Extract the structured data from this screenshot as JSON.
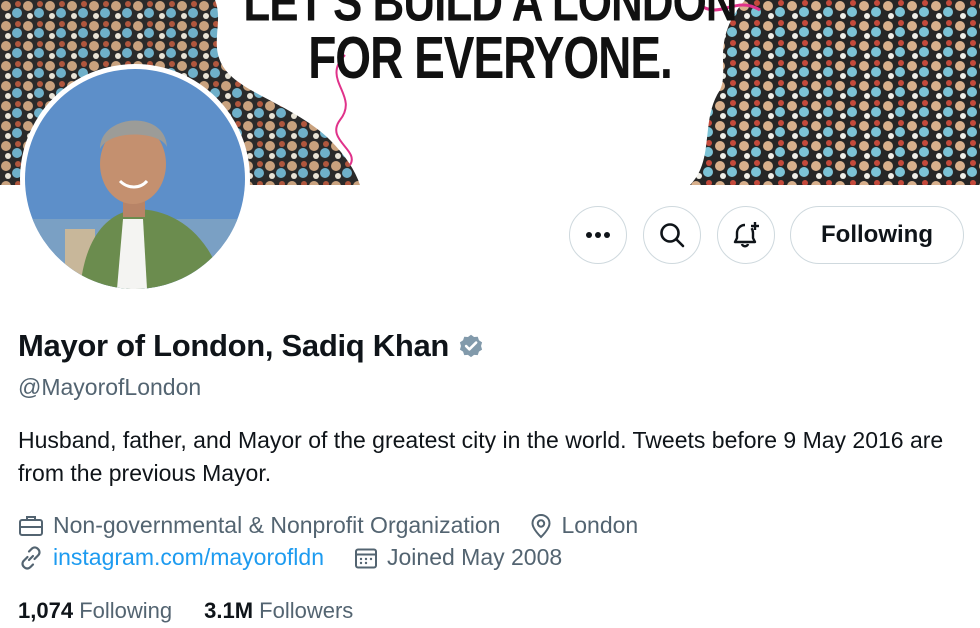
{
  "banner": {
    "line1": "LET'S BUILD A LONDON",
    "line2": "FOR EVERYONE."
  },
  "profile": {
    "name": "Mayor of London, Sadiq Khan",
    "handle": "@MayorofLondon",
    "bio": "Husband, father, and Mayor of the greatest city in the world. Tweets before 9 May 2016 are from the previous Mayor.",
    "category": "Non-governmental & Nonprofit Organization",
    "location": "London",
    "website": "instagram.com/mayorofldn",
    "joined": "Joined May 2008",
    "following_count": "1,074",
    "following_label": "Following",
    "followers_count": "3.1M",
    "followers_label": "Followers"
  },
  "actions": {
    "follow_state": "Following"
  },
  "icons": {
    "more": "ellipsis-icon",
    "search": "search-icon",
    "notify": "bell-plus-icon",
    "verified": "verified-badge-icon",
    "category": "briefcase-icon",
    "location": "location-pin-icon",
    "website": "link-icon",
    "joined": "calendar-icon"
  },
  "colors": {
    "link": "#1d9bf0",
    "secondary_text": "#536471",
    "verified": "#829aab",
    "border": "#cfd9de",
    "accent_pink": "#e0328a"
  }
}
